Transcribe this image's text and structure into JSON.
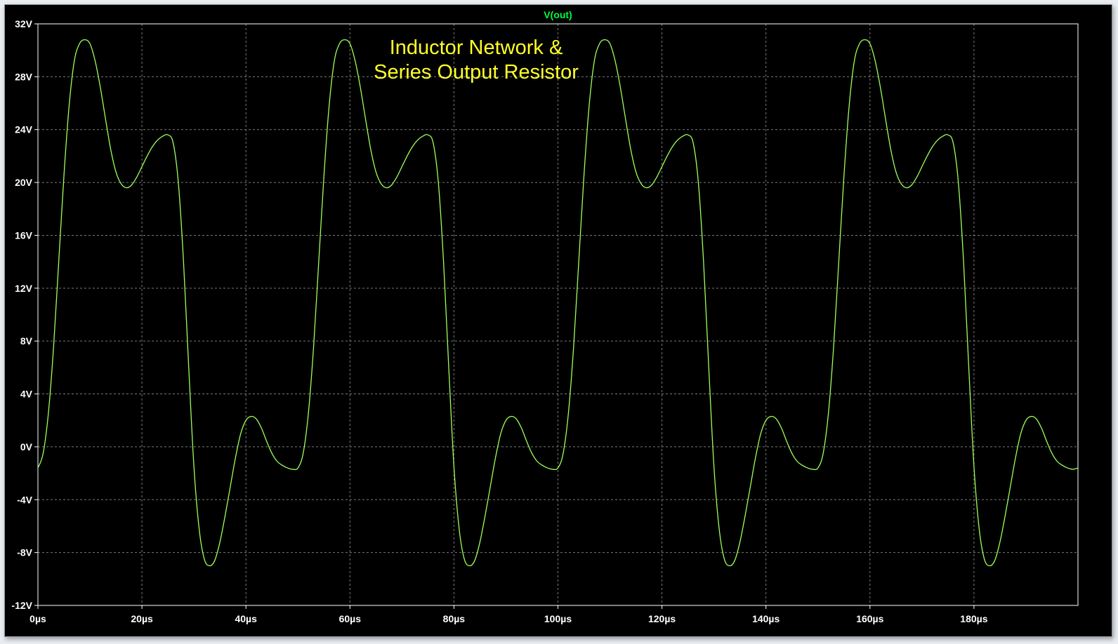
{
  "chart_data": {
    "type": "line",
    "title": "",
    "trace_label": "V(out)",
    "annotation": [
      "Inductor Network &",
      "Series Output Resistor"
    ],
    "xlabel": "",
    "ylabel": "",
    "xlim": [
      0,
      200
    ],
    "ylim": [
      -12,
      32
    ],
    "x_ticks": [
      0,
      20,
      40,
      60,
      80,
      100,
      120,
      140,
      160,
      180
    ],
    "x_tick_labels": [
      "0µs",
      "20µs",
      "40µs",
      "60µs",
      "80µs",
      "100µs",
      "120µs",
      "140µs",
      "160µs",
      "180µs"
    ],
    "y_ticks": [
      32,
      28,
      24,
      20,
      16,
      12,
      8,
      4,
      0,
      -4,
      -8,
      -12
    ],
    "y_tick_labels": [
      "32V",
      "28V",
      "24V",
      "20V",
      "16V",
      "12V",
      "8V",
      "4V",
      "0V",
      "-4V",
      "-8V",
      "-12V"
    ],
    "grid": true,
    "series": [
      {
        "name": "V(out)",
        "x": [
          0,
          1,
          2,
          3,
          4,
          5,
          6,
          7,
          8,
          9,
          10,
          11,
          12,
          13,
          14,
          15,
          16,
          17,
          18,
          19,
          20,
          21,
          22,
          23,
          24,
          25,
          26,
          27,
          28,
          29,
          30,
          31,
          32,
          33,
          34,
          35,
          36,
          37,
          38,
          39,
          40,
          41,
          42,
          43,
          44,
          45,
          46,
          47,
          48,
          49,
          50,
          51,
          52,
          53,
          54,
          55,
          56,
          57,
          58,
          59,
          60,
          61,
          62,
          63,
          64,
          65,
          66,
          67,
          68,
          69,
          70,
          71,
          72,
          73,
          74,
          75,
          76,
          77,
          78,
          79,
          80,
          81,
          82,
          83,
          84,
          85,
          86,
          87,
          88,
          89,
          90,
          91,
          92,
          93,
          94,
          95,
          96,
          97,
          98,
          99,
          100,
          101,
          102,
          103,
          104,
          105,
          106,
          107,
          108,
          109,
          110,
          111,
          112,
          113,
          114,
          115,
          116,
          117,
          118,
          119,
          120,
          121,
          122,
          123,
          124,
          125,
          126,
          127,
          128,
          129,
          130,
          131,
          132,
          133,
          134,
          135,
          136,
          137,
          138,
          139,
          140,
          141,
          142,
          143,
          144,
          145,
          146,
          147,
          148,
          149,
          150,
          151,
          152,
          153,
          154,
          155,
          156,
          157,
          158,
          159,
          160,
          161,
          162,
          163,
          164,
          165,
          166,
          167,
          168,
          169,
          170,
          171,
          172,
          173,
          174,
          175,
          176,
          177,
          178,
          179,
          180,
          181,
          182,
          183,
          184,
          185,
          186,
          187,
          188,
          189,
          190,
          191,
          192,
          193,
          194,
          195,
          196,
          197,
          198,
          199,
          200
        ],
        "y": [
          -1.6,
          -0.5,
          2.5,
          7.5,
          14,
          20.5,
          25.8,
          29.2,
          30.5,
          30.8,
          30.5,
          29.2,
          27.2,
          24.8,
          22.5,
          20.8,
          19.9,
          19.6,
          19.8,
          20.4,
          21.2,
          22.0,
          22.7,
          23.2,
          23.5,
          23.6,
          23.0,
          20.0,
          14.0,
          6.0,
          -1.5,
          -6.2,
          -8.5,
          -9.0,
          -8.6,
          -7.2,
          -5.2,
          -3.0,
          -0.8,
          1.0,
          2.0,
          2.3,
          2.1,
          1.4,
          0.4,
          -0.5,
          -1.1,
          -1.4,
          -1.6,
          -1.7,
          -1.6,
          -0.5,
          2.5,
          7.5,
          14,
          20.5,
          25.8,
          29.2,
          30.5,
          30.8,
          30.5,
          29.2,
          27.2,
          24.8,
          22.5,
          20.8,
          19.9,
          19.6,
          19.8,
          20.4,
          21.2,
          22.0,
          22.7,
          23.2,
          23.5,
          23.6,
          23.0,
          20.0,
          14.0,
          6.0,
          -1.5,
          -6.2,
          -8.5,
          -9.0,
          -8.6,
          -7.2,
          -5.2,
          -3.0,
          -0.8,
          1.0,
          2.0,
          2.3,
          2.1,
          1.4,
          0.4,
          -0.5,
          -1.1,
          -1.4,
          -1.6,
          -1.7,
          -1.6,
          -0.5,
          2.5,
          7.5,
          14,
          20.5,
          25.8,
          29.2,
          30.5,
          30.8,
          30.5,
          29.2,
          27.2,
          24.8,
          22.5,
          20.8,
          19.9,
          19.6,
          19.8,
          20.4,
          21.2,
          22.0,
          22.7,
          23.2,
          23.5,
          23.6,
          23.0,
          20.0,
          14.0,
          6.0,
          -1.5,
          -6.2,
          -8.5,
          -9.0,
          -8.6,
          -7.2,
          -5.2,
          -3.0,
          -0.8,
          1.0,
          2.0,
          2.3,
          2.1,
          1.4,
          0.4,
          -0.5,
          -1.1,
          -1.4,
          -1.6,
          -1.7,
          -1.6,
          -0.5,
          2.5,
          7.5,
          14,
          20.5,
          25.8,
          29.2,
          30.5,
          30.8,
          30.5,
          29.2,
          27.2,
          24.8,
          22.5,
          20.8,
          19.9,
          19.6,
          19.8,
          20.4,
          21.2,
          22.0,
          22.7,
          23.2,
          23.5,
          23.6,
          23.0,
          20.0,
          14.0,
          6.0,
          -1.5,
          -6.2,
          -8.5,
          -9.0,
          -8.6,
          -7.2,
          -5.2,
          -3.0,
          -0.8,
          1.0,
          2.0,
          2.3,
          2.1,
          1.4,
          0.4,
          -0.5,
          -1.1,
          -1.4,
          -1.6,
          -1.7,
          -1.6
        ]
      }
    ]
  },
  "colors": {
    "background": "#000000",
    "grid": "#7a7a7a",
    "trace": "#9cff5a",
    "trace_label": "#00ff3c",
    "annotation": "#ffff28",
    "tick_text": "#ffffff"
  }
}
